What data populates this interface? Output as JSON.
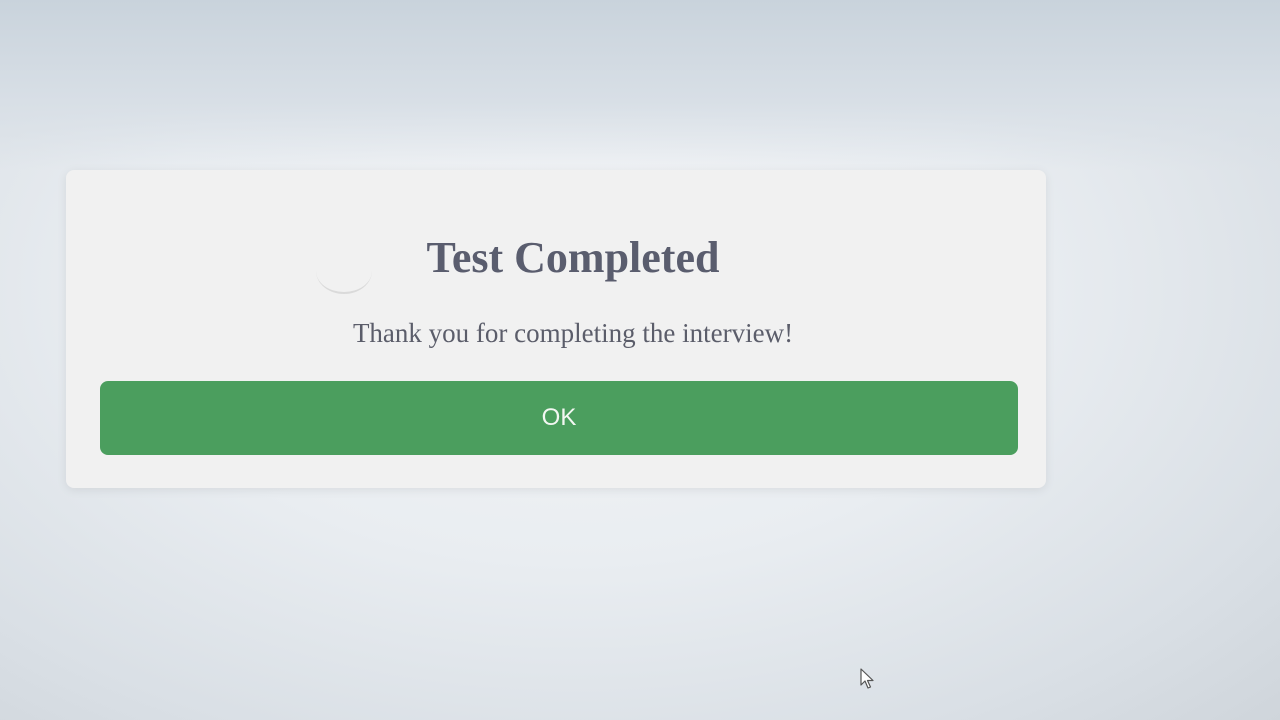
{
  "dialog": {
    "title": "Test Completed",
    "message": "Thank you for completing the interview!",
    "ok_label": "OK"
  },
  "colors": {
    "button_bg": "#4b9e5e",
    "button_text": "#f2f7f2",
    "title_text": "#5a5d6e",
    "dialog_bg": "#f1f1f1"
  },
  "icons": {
    "cursor": "arrow-cursor-icon"
  }
}
